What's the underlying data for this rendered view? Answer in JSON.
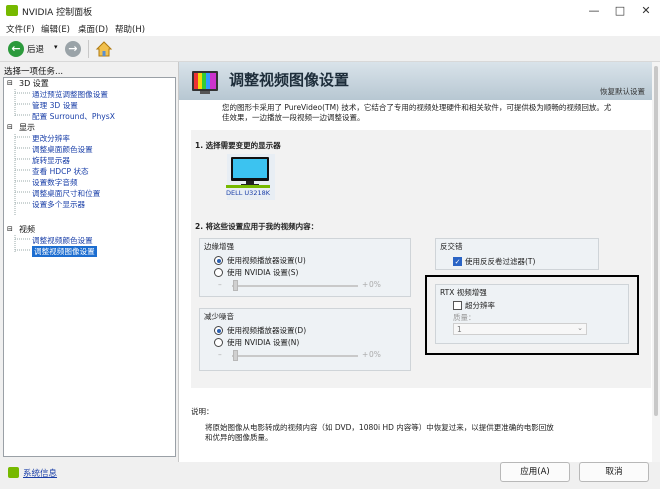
{
  "window": {
    "title": "NVIDIA 控制面板",
    "controls": [
      "—",
      "□",
      "✕"
    ]
  },
  "menu": [
    "文件(F)",
    "编辑(E)",
    "桌面(D)",
    "帮助(H)"
  ],
  "toolbar": {
    "back_label": "后退"
  },
  "left": {
    "task_label": "选择一项任务...",
    "sections": [
      {
        "label": "3D 设置",
        "items": [
          "通过预览调整图像设置",
          "管理 3D 设置",
          "配置 Surround、PhysX"
        ]
      },
      {
        "label": "显示",
        "items": [
          "更改分辨率",
          "调整桌面颜色设置",
          "旋转显示器",
          "查看 HDCP 状态",
          "设置数字音频",
          "调整桌面尺寸和位置",
          "设置多个显示器"
        ]
      },
      {
        "label": "视频",
        "items": [
          "调整视频颜色设置",
          "调整视频图像设置"
        ]
      }
    ]
  },
  "page": {
    "title": "调整视频图像设置",
    "restore": "恢复默认设置",
    "intro_1": "您的图形卡采用了 PureVideo(TM) 技术，它结合了专用的视频处理硬件和相关软件，可提供极为顺畅的视频回放。尤",
    "intro_2": "佳效果，一边播放一段视频一边调整设置。",
    "step1": "1. 选择需要变更的显示器",
    "monitor_label": "DELL U3218K",
    "step2": "2. 将这些设置应用于我的视频内容：",
    "edge": {
      "title": "边缘增强",
      "opt1": "使用视频播放器设置(U)",
      "opt2": "使用 NVIDIA 设置(S)",
      "minus": "–",
      "plus": "+",
      "value": "0%"
    },
    "noise": {
      "title": "减少噪音",
      "opt1": "使用视频播放器设置(D)",
      "opt2": "使用 NVIDIA 设置(N)",
      "minus": "–",
      "plus": "+",
      "value": "0%"
    },
    "deinterlace": {
      "title": "反交错",
      "option": "使用反反卷过滤器(T)",
      "checked": true
    },
    "rtx": {
      "title": "RTX 视频增强",
      "option": "超分辨率",
      "quality_label": "质量：",
      "quality_value": "1",
      "checked": false
    },
    "desc_label": "说明：",
    "desc_1": "将原始图像从电影转成的视频内容（如 DVD，1080i HD 内容等）中恢复过来，以提供更准确的电影回放",
    "desc_2": "和优异的图像质量。"
  },
  "status": {
    "system_info": "系统信息"
  },
  "buttons": {
    "apply": "应用(A)",
    "cancel": "取消"
  },
  "colors": {
    "nvidia_green": "#76b900",
    "link_blue": "#1a3fa8",
    "selection": "#1c6dd0",
    "highlight_box": "#000000"
  }
}
